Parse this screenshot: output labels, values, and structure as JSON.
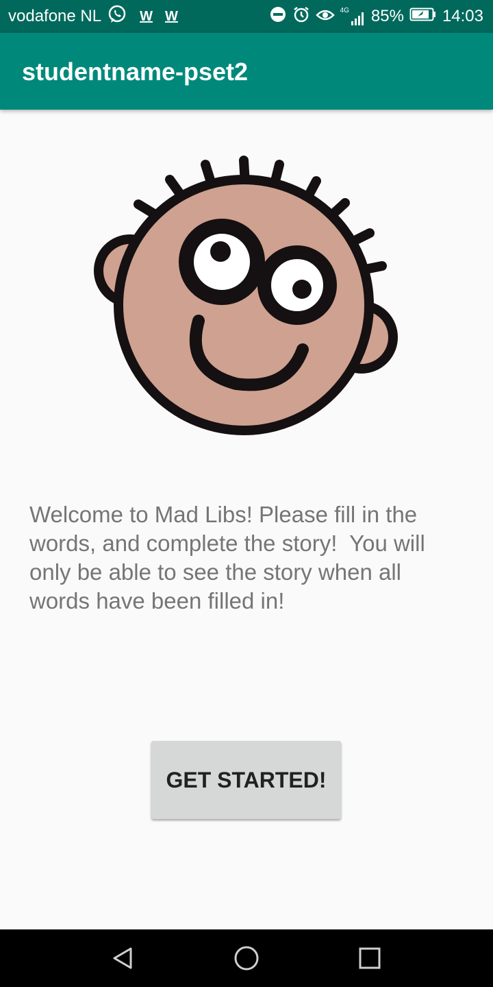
{
  "status_bar": {
    "carrier": "vodafone NL",
    "notif_1": "W",
    "notif_2": "W",
    "network": "4G",
    "battery": "85%",
    "time": "14:03",
    "icons": [
      "whatsapp-icon",
      "dnd-icon",
      "alarm-icon",
      "eye-icon",
      "signal-icon",
      "battery-icon"
    ]
  },
  "app_bar": {
    "title": "studentname-pset2"
  },
  "main": {
    "image": "cartoon-face",
    "welcome_text": "Welcome to Mad Libs! Please fill in the words, and complete the story!  You will only be able to see the story when all words have been filled in!",
    "start_button": "GET STARTED!"
  },
  "nav_bar": {
    "buttons": [
      "back-icon",
      "home-icon",
      "recents-icon"
    ]
  },
  "colors": {
    "status_bar": "#00695c",
    "app_bar": "#00897b",
    "background": "#fafafa",
    "face": "#cfa190",
    "button": "#d6d7d7"
  }
}
